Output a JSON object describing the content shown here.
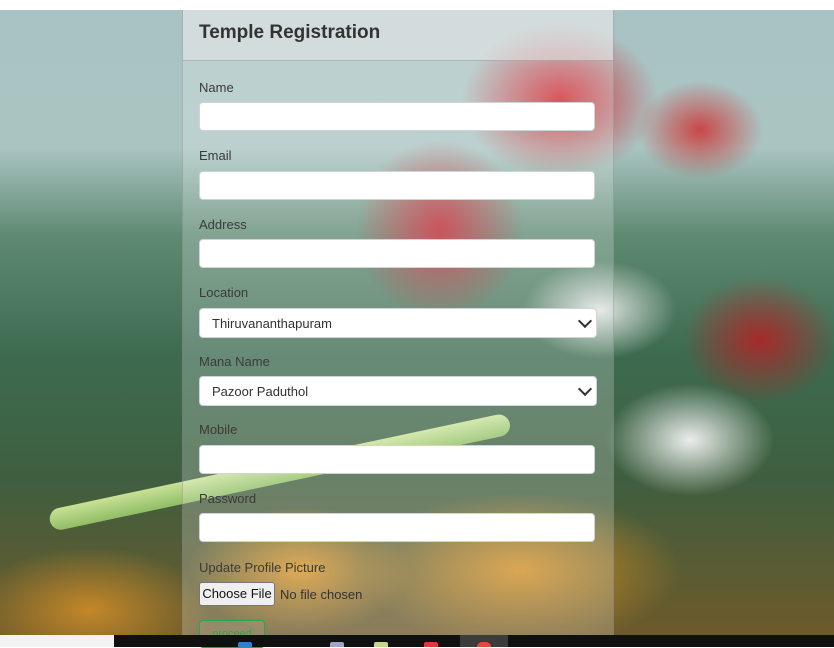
{
  "form": {
    "title": "Temple Registration",
    "fields": {
      "name": {
        "label": "Name",
        "value": ""
      },
      "email": {
        "label": "Email",
        "value": ""
      },
      "address": {
        "label": "Address",
        "value": ""
      },
      "location": {
        "label": "Location",
        "selected": "Thiruvananthapuram"
      },
      "mana_name": {
        "label": "Mana Name",
        "selected": "Pazoor Paduthol"
      },
      "mobile": {
        "label": "Mobile",
        "value": ""
      },
      "password": {
        "label": "Password",
        "value": ""
      },
      "profile_picture": {
        "label": "Update Profile Picture",
        "button": "Choose File",
        "status": "No file chosen"
      }
    },
    "submit_label": "proceed"
  },
  "colors": {
    "submit_accent": "#28a745",
    "taskbar": "#101010"
  }
}
